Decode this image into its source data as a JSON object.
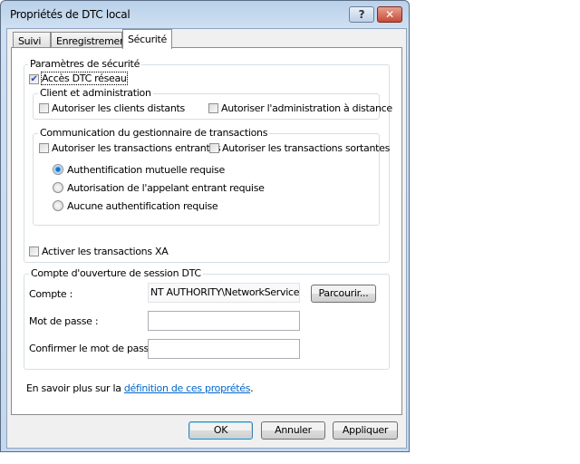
{
  "window": {
    "title": "Propriétés de DTC local",
    "help_label": "?",
    "close_label": "✕"
  },
  "tabs": [
    {
      "label": "Suivi"
    },
    {
      "label": "Enregistrement"
    },
    {
      "label": "Sécurité",
      "selected": true
    }
  ],
  "security": {
    "group_label": "Paramètres de sécurité",
    "network_access": {
      "label": "Accès DTC réseau",
      "checked": true
    },
    "client_admin": {
      "group_label": "Client et administration",
      "allow_remote_clients": {
        "label": "Autoriser les clients distants",
        "checked": false
      },
      "allow_remote_admin": {
        "label": "Autoriser l'administration à distance",
        "checked": false
      }
    },
    "tm_comm": {
      "group_label": "Communication du gestionnaire de transactions",
      "allow_inbound": {
        "label": "Autoriser les transactions entrantes",
        "checked": false
      },
      "allow_outbound": {
        "label": "Autoriser les transactions sortantes",
        "checked": false
      },
      "radios": [
        {
          "label": "Authentification mutuelle requise",
          "selected": true
        },
        {
          "label": "Autorisation de l'appelant entrant requise",
          "selected": false
        },
        {
          "label": "Aucune authentification requise",
          "selected": false
        }
      ]
    },
    "enable_xa": {
      "label": "Activer les transactions XA",
      "checked": false
    }
  },
  "logon": {
    "group_label": "Compte d'ouverture de session DTC",
    "account_label": "Compte :",
    "account_value": "NT AUTHORITY\\NetworkService",
    "browse_label": "Parcourir...",
    "password_label": "Mot de passe :",
    "password_value": "",
    "confirm_label": "Confirmer le mot de passe :",
    "confirm_value": ""
  },
  "learn_more": {
    "prefix": "En savoir plus sur la ",
    "link": "définition de ces proprétés",
    "suffix": "."
  },
  "buttons": {
    "ok": "OK",
    "cancel": "Annuler",
    "apply": "Appliquer"
  },
  "colors": {
    "link": "#0066cc",
    "close_button": "#c75050",
    "radio_selected": "#1d6fd2"
  }
}
